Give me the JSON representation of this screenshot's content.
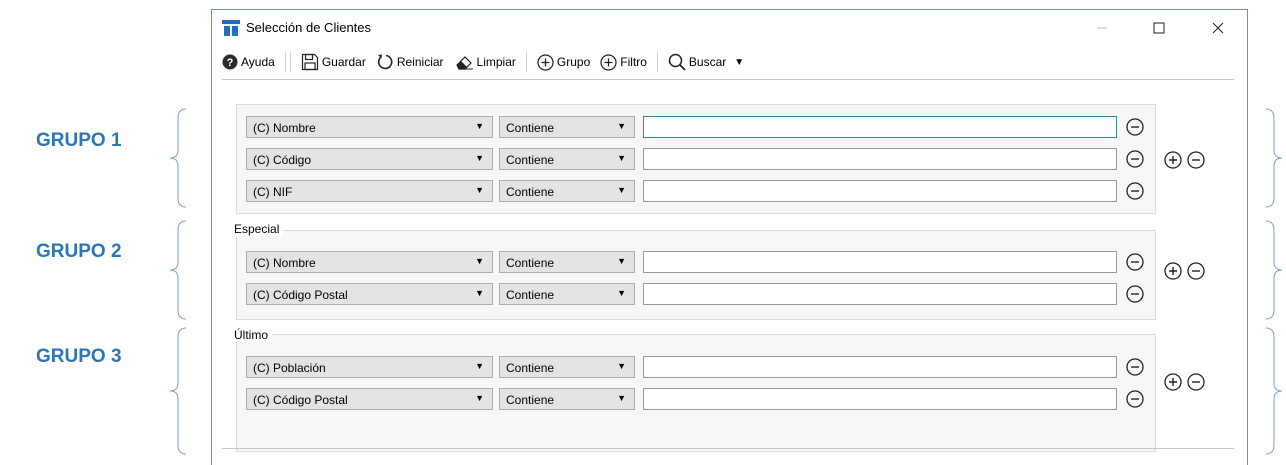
{
  "outer_labels": [
    "GRUPO 1",
    "GRUPO 2",
    "GRUPO 3"
  ],
  "window": {
    "title": "Selección de Clientes"
  },
  "toolbar": {
    "help": "Ayuda",
    "save": "Guardar",
    "reset": "Reiniciar",
    "clear": "Limpiar",
    "group": "Grupo",
    "filter": "Filtro",
    "search": "Buscar"
  },
  "groups": [
    {
      "title": "",
      "rows": [
        {
          "field": "(C) Nombre",
          "operator": "Contiene",
          "value": ""
        },
        {
          "field": "(C) Código",
          "operator": "Contiene",
          "value": ""
        },
        {
          "field": "(C) NIF",
          "operator": "Contiene",
          "value": ""
        }
      ]
    },
    {
      "title": "Especial",
      "rows": [
        {
          "field": "(C) Nombre",
          "operator": "Contiene",
          "value": ""
        },
        {
          "field": "(C) Código Postal",
          "operator": "Contiene",
          "value": ""
        }
      ]
    },
    {
      "title": "Último",
      "rows": [
        {
          "field": "(C) Población",
          "operator": "Contiene",
          "value": ""
        },
        {
          "field": "(C) Código Postal",
          "operator": "Contiene",
          "value": ""
        }
      ]
    }
  ]
}
